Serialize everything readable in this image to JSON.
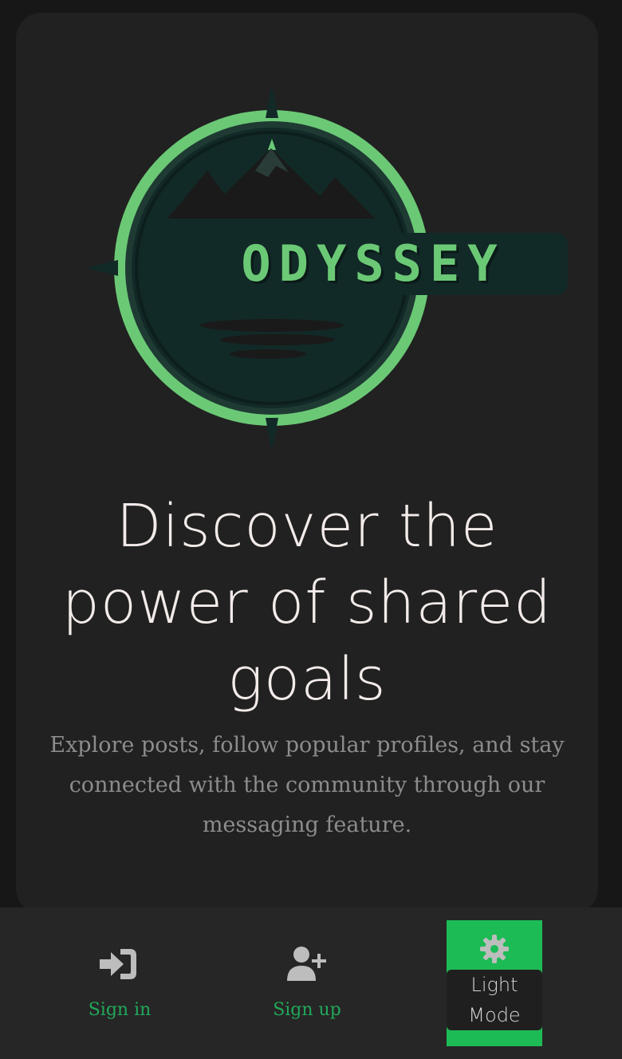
{
  "logo": {
    "text": "ODYSSEY",
    "colors": {
      "ring": "#6bc976",
      "inner": "#122a27",
      "letters": "#6bc976"
    }
  },
  "hero": {
    "headline": "Discover the power of shared goals",
    "subtext": "Explore posts, follow popular profiles, and stay connected with the community through our messaging feature."
  },
  "nav": {
    "sign_in": {
      "label": "Sign in",
      "icon": "sign-in-icon"
    },
    "sign_up": {
      "label": "Sign up",
      "icon": "user-plus-icon"
    },
    "mode": {
      "label": "Light Mode",
      "icon": "gear-icon"
    }
  },
  "colors": {
    "background": "#171717",
    "card": "#212121",
    "accent": "#1dbb56",
    "nav_label": "#21a85a",
    "headline": "#f2ebe9",
    "subtext": "#8c8c8c"
  }
}
